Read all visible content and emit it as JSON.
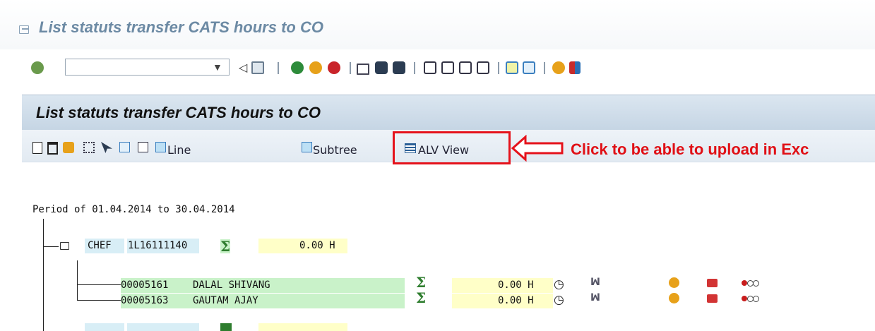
{
  "window": {
    "title": "List statuts transfer CATS hours to CO"
  },
  "toolbar": {
    "command_value": "",
    "icons": [
      "enter-icon",
      "back-icon",
      "save-icon",
      "back-green-icon",
      "exit-icon",
      "cancel-icon",
      "print-icon",
      "find-icon",
      "find-next-icon",
      "first-page-icon",
      "prev-page-icon",
      "next-page-icon",
      "last-page-icon",
      "new-session-icon",
      "shortcut-icon",
      "help-icon",
      "customize-layout-icon"
    ]
  },
  "panel": {
    "title": "List statuts transfer CATS hours to CO",
    "buttons": {
      "line_label": "Line",
      "subtree_label": "Subtree",
      "alv_label": "ALV View"
    }
  },
  "annotation": {
    "callout": "Click to be able to upload in Exc"
  },
  "report": {
    "period_text": "Period of 01.04.2014  to 30.04.2014",
    "root": {
      "role": "CHEF",
      "id": "1L16111140",
      "total": "0.00 H"
    },
    "rows": [
      {
        "number": "00005161",
        "name": "DALAL SHIVANG",
        "hours": "0.00 H"
      },
      {
        "number": "00005163",
        "name": "GAUTAM AJAY",
        "hours": "0.00 H"
      }
    ]
  },
  "colors": {
    "accent_red": "#e5121b",
    "green_cell": "#c9f2c9",
    "yellow_cell": "#ffffc8"
  }
}
